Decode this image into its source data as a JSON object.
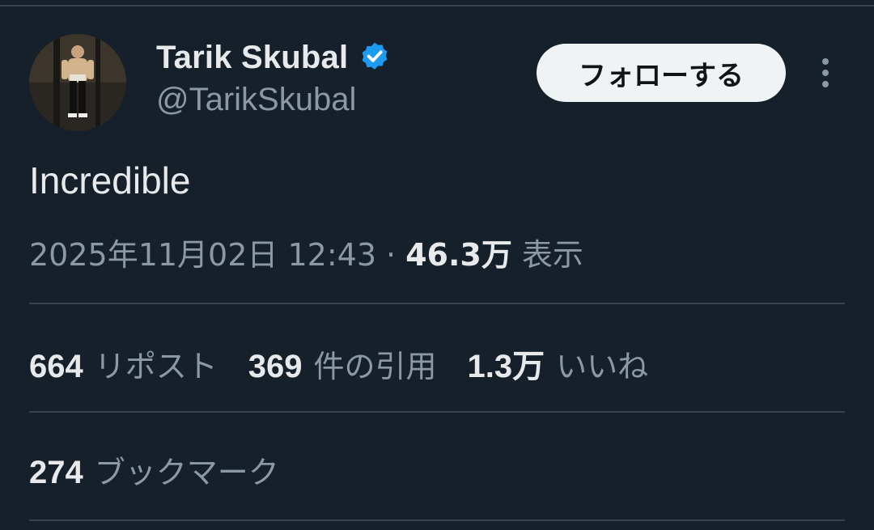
{
  "author": {
    "display_name": "Tarik Skubal",
    "handle": "@TarikSkubal",
    "verified": true
  },
  "header": {
    "follow_label": "フォローする"
  },
  "tweet": {
    "text": "Incredible",
    "timestamp": "2025年11月02日 12:43",
    "separator": "·",
    "views_count": "46.3万",
    "views_label": "表示"
  },
  "stats": {
    "reposts_count": "664",
    "reposts_label": "リポスト",
    "quotes_count": "369",
    "quotes_label": "件の引用",
    "likes_count": "1.3万",
    "likes_label": "いいね",
    "bookmarks_count": "274",
    "bookmarks_label": "ブックマーク"
  },
  "colors": {
    "background": "#15202b",
    "text_primary": "#e7e9ea",
    "text_secondary": "#8b98a5",
    "divider": "#38444d",
    "verified_blue": "#1d9bf0",
    "follow_button_bg": "#eff3f4"
  },
  "icons": {
    "verified": "verified-badge-icon",
    "more": "more-vertical-icon"
  }
}
